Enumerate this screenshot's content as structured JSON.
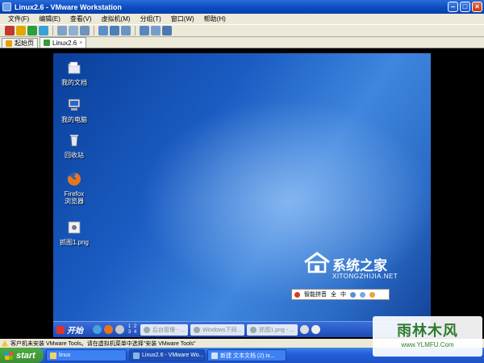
{
  "window": {
    "title": "Linux2.6 - VMware Workstation"
  },
  "menu": [
    "文件(F)",
    "编辑(E)",
    "查看(V)",
    "虚拟机(M)",
    "分组(T)",
    "窗口(W)",
    "帮助(H)"
  ],
  "tabs": [
    {
      "label": "起始页",
      "active": false
    },
    {
      "label": "Linux2.6",
      "active": true
    }
  ],
  "guest": {
    "icons": [
      {
        "label": "我的文档",
        "icon": "folder-icon"
      },
      {
        "label": "我的电脑",
        "icon": "computer-icon"
      },
      {
        "label": "回收站",
        "icon": "trash-icon"
      },
      {
        "label": "Firefox\n浏览器",
        "label_line1": "Firefox",
        "label_line2": "浏览器",
        "icon": "firefox-icon"
      },
      {
        "label": "抓图1.png",
        "icon": "image-file-icon"
      }
    ],
    "watermark": {
      "cn": "系统之家",
      "en": "XITONGZHIJIA.NET"
    },
    "ime": {
      "label": "智能拼音",
      "mode1": "全",
      "mode2": "中"
    },
    "taskbar": {
      "start_label": "开始",
      "pager": [
        "1",
        "2",
        "3",
        "4"
      ],
      "tasks": [
        "后台管理 - ...",
        "Windows下同...",
        "抓图1.png - ..."
      ]
    }
  },
  "statusbar": {
    "message": "客户机未安装 VMware Tools。请在虚拟机菜单中选择\"安装 VMware Tools\""
  },
  "host_taskbar": {
    "start_label": "start",
    "tasks": [
      {
        "label": "linux",
        "active": false
      },
      {
        "label": "Linux2.6 - VMware Wo...",
        "active": true
      },
      {
        "label": "新建 文本文档 (2).tx...",
        "active": false
      }
    ]
  },
  "badge": {
    "big": "雨林木风",
    "small": "www.YLMFU.Com"
  },
  "colors": {
    "titlebar": "#0a4bc0",
    "desktop": "#1a5cc2",
    "start": "#3b8f34"
  }
}
